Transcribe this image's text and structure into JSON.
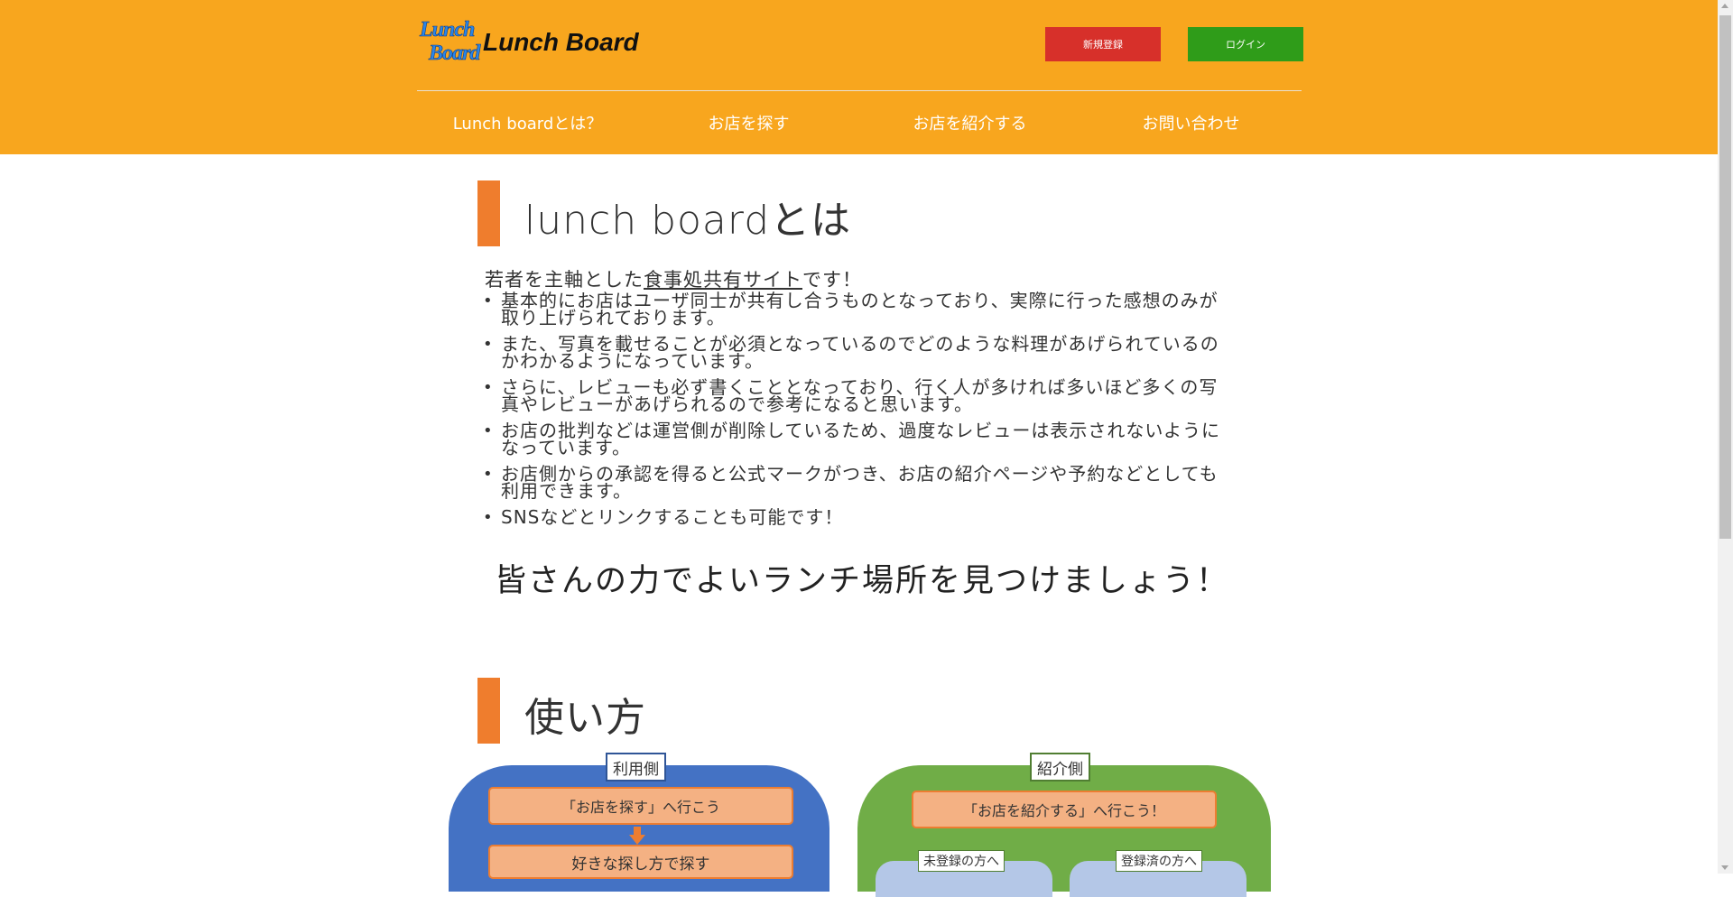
{
  "header": {
    "logo": {
      "mark_line1": "Lunch",
      "mark_line2": "Board",
      "text": "Lunch Board"
    },
    "register_label": "新規登録",
    "login_label": "ログイン",
    "brand_color": "#f8a61e"
  },
  "nav": {
    "items": [
      {
        "label": "Lunch boardとは？"
      },
      {
        "label": "お店を探す"
      },
      {
        "label": "お店を紹介する"
      },
      {
        "label": "お問い合わせ"
      }
    ]
  },
  "about": {
    "title": "lunch boardとは",
    "intro_before": "若者を主軸とした",
    "intro_link": "食事処共有サイト",
    "intro_after": "です！",
    "bullets": [
      "基本的にお店はユーザ同士が共有し合うものとなっており、実際に行った感想のみが取り上げられております。",
      "また、写真を載せることが必須となっているのでどのような料理があげられているのかわかるようになっています。",
      "さらに、レビューも必ず書くこととなっており、行く人が多ければ多いほど多くの写真やレビューがあげられるので参考になると思います。",
      "お店の批判などは運営側が削除しているため、過度なレビューは表示されないようになっています。",
      "お店側からの承認を得ると公式マークがつき、お店の紹介ページや予約などとしても利用できます。",
      "SNSなどとリンクすることも可能です！"
    ],
    "tagline": "皆さんの力でよいランチ場所を見つけましょう！"
  },
  "usage": {
    "title": "使い方",
    "user_side": {
      "label": "利用側",
      "step1": "「お店を探す」へ行こう",
      "step2": "好きな探し方で探す",
      "arrow_icon": "arrow-down-icon"
    },
    "intro_side": {
      "label": "紹介側",
      "step1": "「お店を紹介する」へ行こう！",
      "unregistered": "未登録の方へ",
      "registered": "登録済の方へ"
    }
  },
  "colors": {
    "accent_bar": "#ef7d2d",
    "register": "#d7302a",
    "login": "#2f9c19",
    "user_panel": "#4472c4",
    "intro_panel": "#70ad47",
    "step_fill": "#f4b183"
  }
}
